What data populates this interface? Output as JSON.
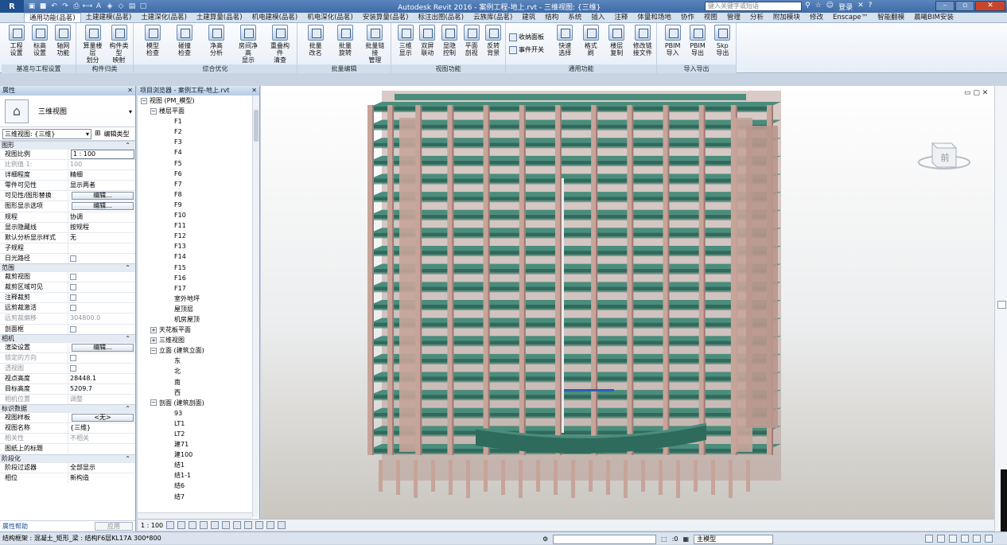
{
  "titlebar": {
    "app_button": "R",
    "title": "Autodesk Revit 2016 -    案例工程-地上.rvt - 三维视图: {三维}",
    "search_placeholder": "键入关键字或短语",
    "login": "登录"
  },
  "tabs": [
    "通用功能(品茗)",
    "土建建模(品茗)",
    "土建深化(品茗)",
    "土建算量(品茗)",
    "机电建模(品茗)",
    "机电深化(品茗)",
    "安装算量(品茗)",
    "标注出图(品茗)",
    "云族库(品茗)",
    "建筑",
    "结构",
    "系统",
    "插入",
    "注释",
    "体量和场地",
    "协作",
    "视图",
    "管理",
    "分析",
    "附加模块",
    "修改",
    "Enscape™",
    "智能翻模",
    "晨曦BIM安装"
  ],
  "ribbon": {
    "groups": [
      {
        "label": "基准与工程设置",
        "buttons": [
          "工程\n设置",
          "标高\n设置",
          "轴网\n功能"
        ]
      },
      {
        "label": "构件归类",
        "buttons": [
          "算量楼层\n划分",
          "构件类型\n映射"
        ]
      },
      {
        "label": "综合优化",
        "buttons": [
          "模型\n检查",
          "碰撞\n检查",
          "净高\n分析",
          "房间净高\n显示",
          "重叠构件\n清查"
        ]
      },
      {
        "label": "批量编辑",
        "buttons": [
          "批量\n改名",
          "批量\n旋转",
          "批量链接\n管理"
        ]
      },
      {
        "label": "视图功能",
        "buttons": [
          "三维\n显示",
          "双屏\n联动",
          "显隐\n控制",
          "平面\n剖视",
          "反转\n背景"
        ]
      },
      {
        "label": "通用功能",
        "small": [
          "收纳面板",
          "事件开关"
        ],
        "buttons": [
          "快速\n选择",
          "格式\n刷",
          "楼层\n复制",
          "修改链\n接文件"
        ]
      },
      {
        "label": "导入导出",
        "buttons": [
          "PBIM\n导入",
          "PBIM\n导出",
          "Skp\n导出"
        ]
      }
    ]
  },
  "properties": {
    "title": "属性",
    "type_name": "三维视图",
    "type_selector": "三维视图: {三维}",
    "edit_type": "编辑类型",
    "groups": [
      {
        "name": "图形",
        "rows": [
          {
            "n": "视图比例",
            "v": "1 : 100",
            "kind": "input"
          },
          {
            "n": "比例值 1:",
            "v": "100",
            "kind": "gray"
          },
          {
            "n": "详细程度",
            "v": "精细"
          },
          {
            "n": "零件可见性",
            "v": "显示两者"
          },
          {
            "n": "可见性/图形替换",
            "v": "编辑...",
            "kind": "button"
          },
          {
            "n": "图形显示选项",
            "v": "编辑...",
            "kind": "button"
          },
          {
            "n": "规程",
            "v": "协调"
          },
          {
            "n": "显示隐藏线",
            "v": "按规程"
          },
          {
            "n": "默认分析显示样式",
            "v": "无"
          },
          {
            "n": "子规程",
            "v": ""
          },
          {
            "n": "日光路径",
            "v": "",
            "kind": "check"
          }
        ]
      },
      {
        "name": "范围",
        "rows": [
          {
            "n": "裁剪视图",
            "v": "",
            "kind": "check"
          },
          {
            "n": "裁剪区域可见",
            "v": "",
            "kind": "check"
          },
          {
            "n": "注释裁剪",
            "v": "",
            "kind": "check"
          },
          {
            "n": "远剪裁激活",
            "v": "",
            "kind": "check"
          },
          {
            "n": "远剪裁偏移",
            "v": "304800.0",
            "kind": "gray"
          },
          {
            "n": "剖面框",
            "v": "",
            "kind": "check"
          }
        ]
      },
      {
        "name": "相机",
        "rows": [
          {
            "n": "渲染设置",
            "v": "编辑...",
            "kind": "button"
          },
          {
            "n": "锁定的方向",
            "v": "",
            "kind": "checkgray"
          },
          {
            "n": "透视图",
            "v": "",
            "kind": "checkgray"
          },
          {
            "n": "视点高度",
            "v": "28448.1"
          },
          {
            "n": "目标高度",
            "v": "5209.7"
          },
          {
            "n": "相机位置",
            "v": "调整",
            "kind": "gray"
          }
        ]
      },
      {
        "name": "标识数据",
        "rows": [
          {
            "n": "视图样板",
            "v": "<无>",
            "kind": "button"
          },
          {
            "n": "视图名称",
            "v": "{三维}"
          },
          {
            "n": "相关性",
            "v": "不相关",
            "kind": "gray"
          },
          {
            "n": "图纸上的标题",
            "v": ""
          }
        ]
      },
      {
        "name": "阶段化",
        "rows": [
          {
            "n": "阶段过滤器",
            "v": "全部显示"
          },
          {
            "n": "相位",
            "v": "新构造"
          }
        ]
      }
    ],
    "help": "属性帮助",
    "apply": "应用"
  },
  "browser": {
    "title": "项目浏览器 - 案例工程-地上.rvt",
    "nodes": [
      {
        "t": "视图 (PM_模型)",
        "lvl": 0,
        "ex": "-"
      },
      {
        "t": "楼层平面",
        "lvl": 1,
        "ex": "-"
      },
      {
        "t": "F1",
        "lvl": 2
      },
      {
        "t": "F2",
        "lvl": 2
      },
      {
        "t": "F3",
        "lvl": 2
      },
      {
        "t": "F4",
        "lvl": 2
      },
      {
        "t": "F5",
        "lvl": 2
      },
      {
        "t": "F6",
        "lvl": 2
      },
      {
        "t": "F7",
        "lvl": 2
      },
      {
        "t": "F8",
        "lvl": 2
      },
      {
        "t": "F9",
        "lvl": 2
      },
      {
        "t": "F10",
        "lvl": 2
      },
      {
        "t": "F11",
        "lvl": 2
      },
      {
        "t": "F12",
        "lvl": 2
      },
      {
        "t": "F13",
        "lvl": 2
      },
      {
        "t": "F14",
        "lvl": 2
      },
      {
        "t": "F15",
        "lvl": 2
      },
      {
        "t": "F16",
        "lvl": 2
      },
      {
        "t": "F17",
        "lvl": 2
      },
      {
        "t": "室外地坪",
        "lvl": 2
      },
      {
        "t": "屋顶层",
        "lvl": 2
      },
      {
        "t": "机房屋顶",
        "lvl": 2
      },
      {
        "t": "天花板平面",
        "lvl": 1,
        "ex": "+"
      },
      {
        "t": "三维视图",
        "lvl": 1,
        "ex": "+"
      },
      {
        "t": "立面 (建筑立面)",
        "lvl": 1,
        "ex": "-"
      },
      {
        "t": "东",
        "lvl": 2
      },
      {
        "t": "北",
        "lvl": 2
      },
      {
        "t": "南",
        "lvl": 2
      },
      {
        "t": "西",
        "lvl": 2
      },
      {
        "t": "剖面 (建筑剖面)",
        "lvl": 1,
        "ex": "-"
      },
      {
        "t": "93",
        "lvl": 2
      },
      {
        "t": "LT1",
        "lvl": 2
      },
      {
        "t": "LT2",
        "lvl": 2
      },
      {
        "t": "建71",
        "lvl": 2
      },
      {
        "t": "建100",
        "lvl": 2
      },
      {
        "t": "结1",
        "lvl": 2
      },
      {
        "t": "结1-1",
        "lvl": 2
      },
      {
        "t": "结6",
        "lvl": 2
      },
      {
        "t": "结7",
        "lvl": 2
      }
    ]
  },
  "viewport": {
    "viewcube_label": "前",
    "floors": 19,
    "colors": {
      "slab": "#2f6b5c",
      "slab_top": "#4a8d7c",
      "column": "#c7a49a",
      "column_dark": "#9c7c74",
      "beam": "#3e7f6c"
    }
  },
  "view_control": {
    "scale": "1 : 100"
  },
  "status": {
    "text": "结构框架 : 混凝土_矩形_梁 : 结构F6层KL17A 300*800",
    "zero": ":0",
    "model": "主模型"
  }
}
